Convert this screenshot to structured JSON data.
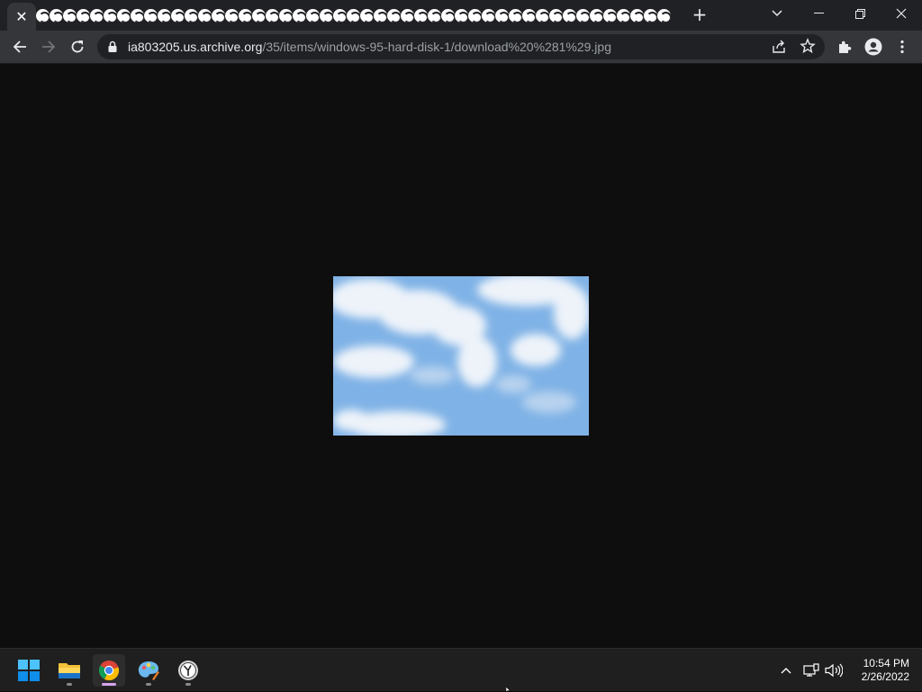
{
  "browser": {
    "active_tab_close": "✕",
    "tab_count": 47,
    "new_tab": "+",
    "url_host": "ia803205.us.archive.org",
    "url_path": "/35/items/windows-95-hard-disk-1/download%20%281%29.jpg"
  },
  "content": {
    "image_subject": "sky with white clouds"
  },
  "taskbar": {
    "apps": [
      "start",
      "file-explorer",
      "chrome",
      "paint",
      "clock-app"
    ],
    "time": "10:54 PM",
    "date": "2/26/2022"
  },
  "colors": {
    "tabstrip_bg": "#202124",
    "toolbar_bg": "#35363a",
    "content_bg": "#0e0e0e",
    "taskbar_bg": "#1f1f1f",
    "sky_blue": "#7fb2e6",
    "active_indicator": "#d7a3ef"
  }
}
